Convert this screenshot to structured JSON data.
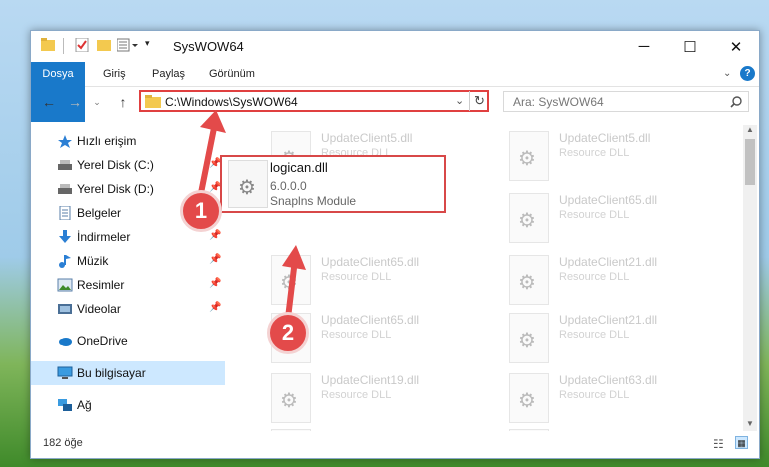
{
  "window": {
    "title": "SysWOW64",
    "controls": {
      "minimize": "─",
      "maximize": "☐",
      "close": "✕"
    }
  },
  "ribbon": {
    "tabs": [
      "Dosya",
      "Giriş",
      "Paylaş",
      "Görünüm"
    ]
  },
  "address": {
    "path": "C:\\Windows\\SysWOW64",
    "search_placeholder": "Ara: SysWOW64"
  },
  "sidebar": {
    "items": [
      {
        "label": "Hızlı erişim",
        "icon": "star-icon",
        "pinned": false
      },
      {
        "label": "Yerel Disk (C:)",
        "icon": "drive-icon",
        "pinned": true
      },
      {
        "label": "Yerel Disk (D:)",
        "icon": "drive-icon",
        "pinned": true
      },
      {
        "label": "Belgeler",
        "icon": "documents-icon",
        "pinned": true
      },
      {
        "label": "İndirmeler",
        "icon": "download-icon",
        "pinned": true
      },
      {
        "label": "Müzik",
        "icon": "music-icon",
        "pinned": true
      },
      {
        "label": "Resimler",
        "icon": "pictures-icon",
        "pinned": true
      },
      {
        "label": "Videolar",
        "icon": "video-icon",
        "pinned": true
      },
      {
        "label": "OneDrive",
        "icon": "cloud-icon",
        "pinned": false
      },
      {
        "label": "Bu bilgisayar",
        "icon": "computer-icon",
        "pinned": false
      },
      {
        "label": "Ağ",
        "icon": "network-icon",
        "pinned": false
      }
    ]
  },
  "files": [
    {
      "name": "UpdateClient5.dll",
      "desc": "Resource DLL"
    },
    {
      "name": "UpdateClient5.dll",
      "desc": "Resource DLL"
    },
    {
      "name": "UpdateClient65.dll",
      "desc": "Resource DLL"
    },
    {
      "name": "UpdateClient65.dll",
      "desc": "Resource DLL"
    },
    {
      "name": "UpdateClient65.dll",
      "desc": "Resource DLL"
    },
    {
      "name": "UpdateClient21.dll",
      "desc": "Resource DLL"
    },
    {
      "name": "UpdateClient65.dll",
      "desc": "Resource DLL"
    },
    {
      "name": "UpdateClient21.dll",
      "desc": "Resource DLL"
    },
    {
      "name": "UpdateClient19.dll",
      "desc": "Resource DLL"
    },
    {
      "name": "UpdateClient63.dll",
      "desc": "Resource DLL"
    }
  ],
  "highlighted_file": {
    "name": "logican.dll",
    "version": "6.0.0.0",
    "description": "Snaplns Module"
  },
  "annotations": {
    "step1": "1",
    "step2": "2"
  },
  "status": {
    "count": "182 öğe"
  },
  "colors": {
    "accent": "#1979ca",
    "annotation": "#e34a4a"
  }
}
